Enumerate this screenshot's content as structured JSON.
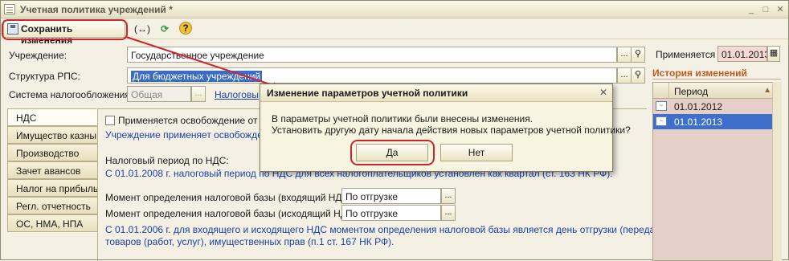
{
  "window": {
    "title": "Учетная политика учреждений *"
  },
  "toolbar": {
    "save_label": "Сохранить изменения",
    "help_icon": "?"
  },
  "form": {
    "institution_label": "Учреждение:",
    "institution_value": "Государственное учреждение",
    "rps_label": "Структура РПС:",
    "rps_value": "Для бюджетных учреждений",
    "tax_system_label": "Система налогообложения:",
    "tax_system_value": "Общая",
    "tax_link": "Налоговы",
    "applies_label": "Применяется с:",
    "applies_date": "01.01.2013"
  },
  "tabs": [
    "НДС",
    "Имущество казны",
    "Производство",
    "Зачет авансов",
    "Налог на прибыль",
    "Регл. отчетность",
    "ОС, НМА, НПА"
  ],
  "vat": {
    "exemption_checkbox": "Применяется освобождение от упла",
    "exemption_link": "Учреждение применяет освобождение",
    "period_label": "Налоговый период по НДС:",
    "period_text": "С 01.01.2008 г. налоговый период по НДС для всех налогоплательщиков установлен как квартал (ст. 163 НК РФ).",
    "base_in_label": "Момент определения налоговой базы (входящий НДС):",
    "base_in_value": "По отгрузке",
    "base_out_label": "Момент определения налоговой базы (исходящий НДС):",
    "base_out_value": "По отгрузке",
    "note_line1": "С 01.01.2006 г. для входящего и исходящего НДС моментом определения налоговой базы является день отгрузки (передачи)",
    "note_line2": "товаров (работ, услуг), имущественных прав (п.1 ст. 167 НК РФ)."
  },
  "history": {
    "title": "История изменений",
    "column": "Период",
    "rows": [
      "01.01.2012",
      "01.01.2013"
    ]
  },
  "dialog": {
    "title": "Изменение параметров учетной политики",
    "line1": "В параметры учетной политики были внесены изменения.",
    "line2": "Установить другую дату начала действия новых параметров учетной политики?",
    "yes": "Да",
    "no": "Нет"
  },
  "colors": {
    "annotation": "#d2232a",
    "selection": "#3d6fcb",
    "link": "#1c3fa6",
    "history_title": "#c1571e"
  }
}
